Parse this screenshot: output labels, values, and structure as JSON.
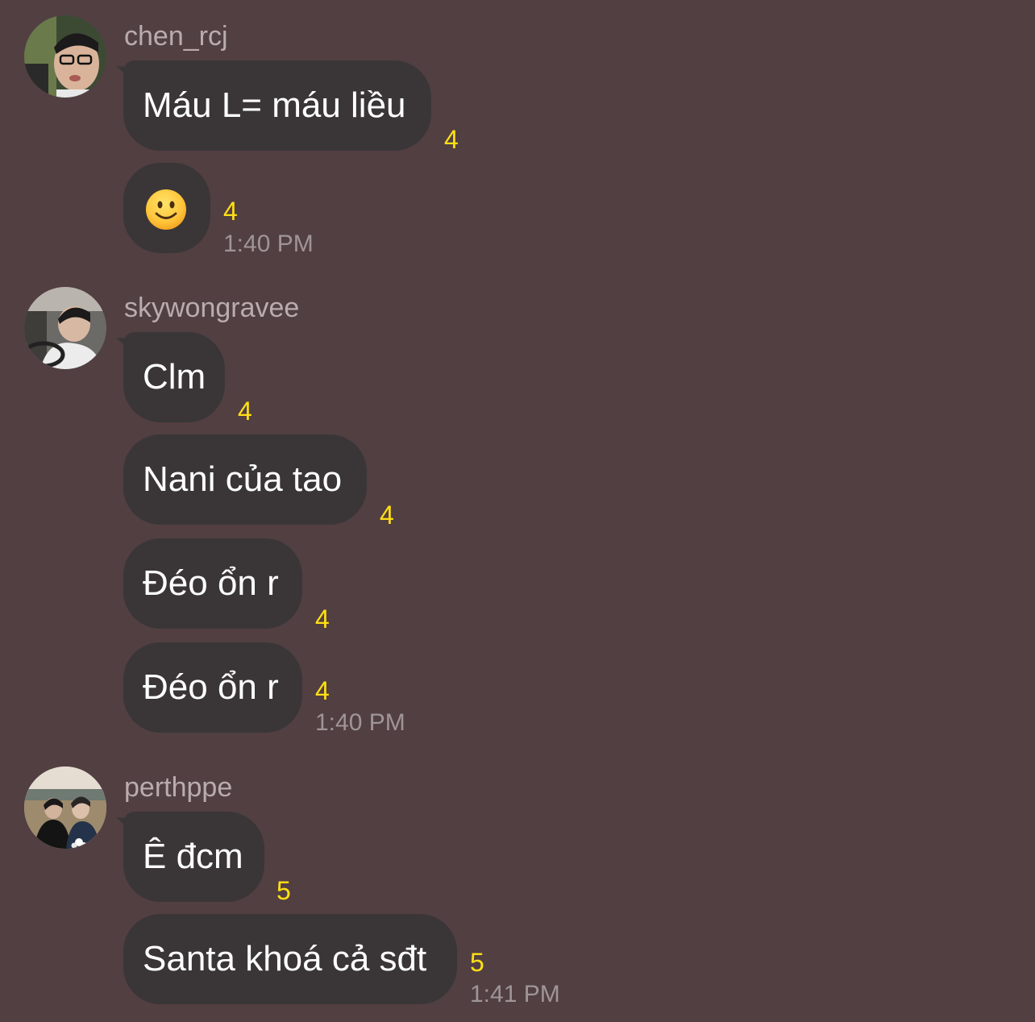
{
  "groups": [
    {
      "sender": "chen_rcj",
      "messages": [
        {
          "text": "Máu L= máu liều",
          "count": "4"
        },
        {
          "text": "",
          "count": "4",
          "emoji": "slightly-smiling-face-icon"
        }
      ],
      "time": "1:40 PM"
    },
    {
      "sender": "skywongravee",
      "messages": [
        {
          "text": "Clm",
          "count": "4"
        },
        {
          "text": "Nani của tao",
          "count": "4"
        },
        {
          "text": "Đéo ổn r",
          "count": "4"
        },
        {
          "text": "Đéo ổn r",
          "count": "4"
        }
      ],
      "time": "1:40 PM"
    },
    {
      "sender": "perthppe",
      "messages": [
        {
          "text": "Ê đcm",
          "count": "5"
        },
        {
          "text": "Santa khoá cả sđt",
          "count": "5"
        }
      ],
      "time": "1:41 PM"
    }
  ],
  "colors": {
    "background": "#523f42",
    "bubble": "#3a3637",
    "count": "#ffe013",
    "sender": "#b9acae",
    "time": "#9f9597"
  }
}
